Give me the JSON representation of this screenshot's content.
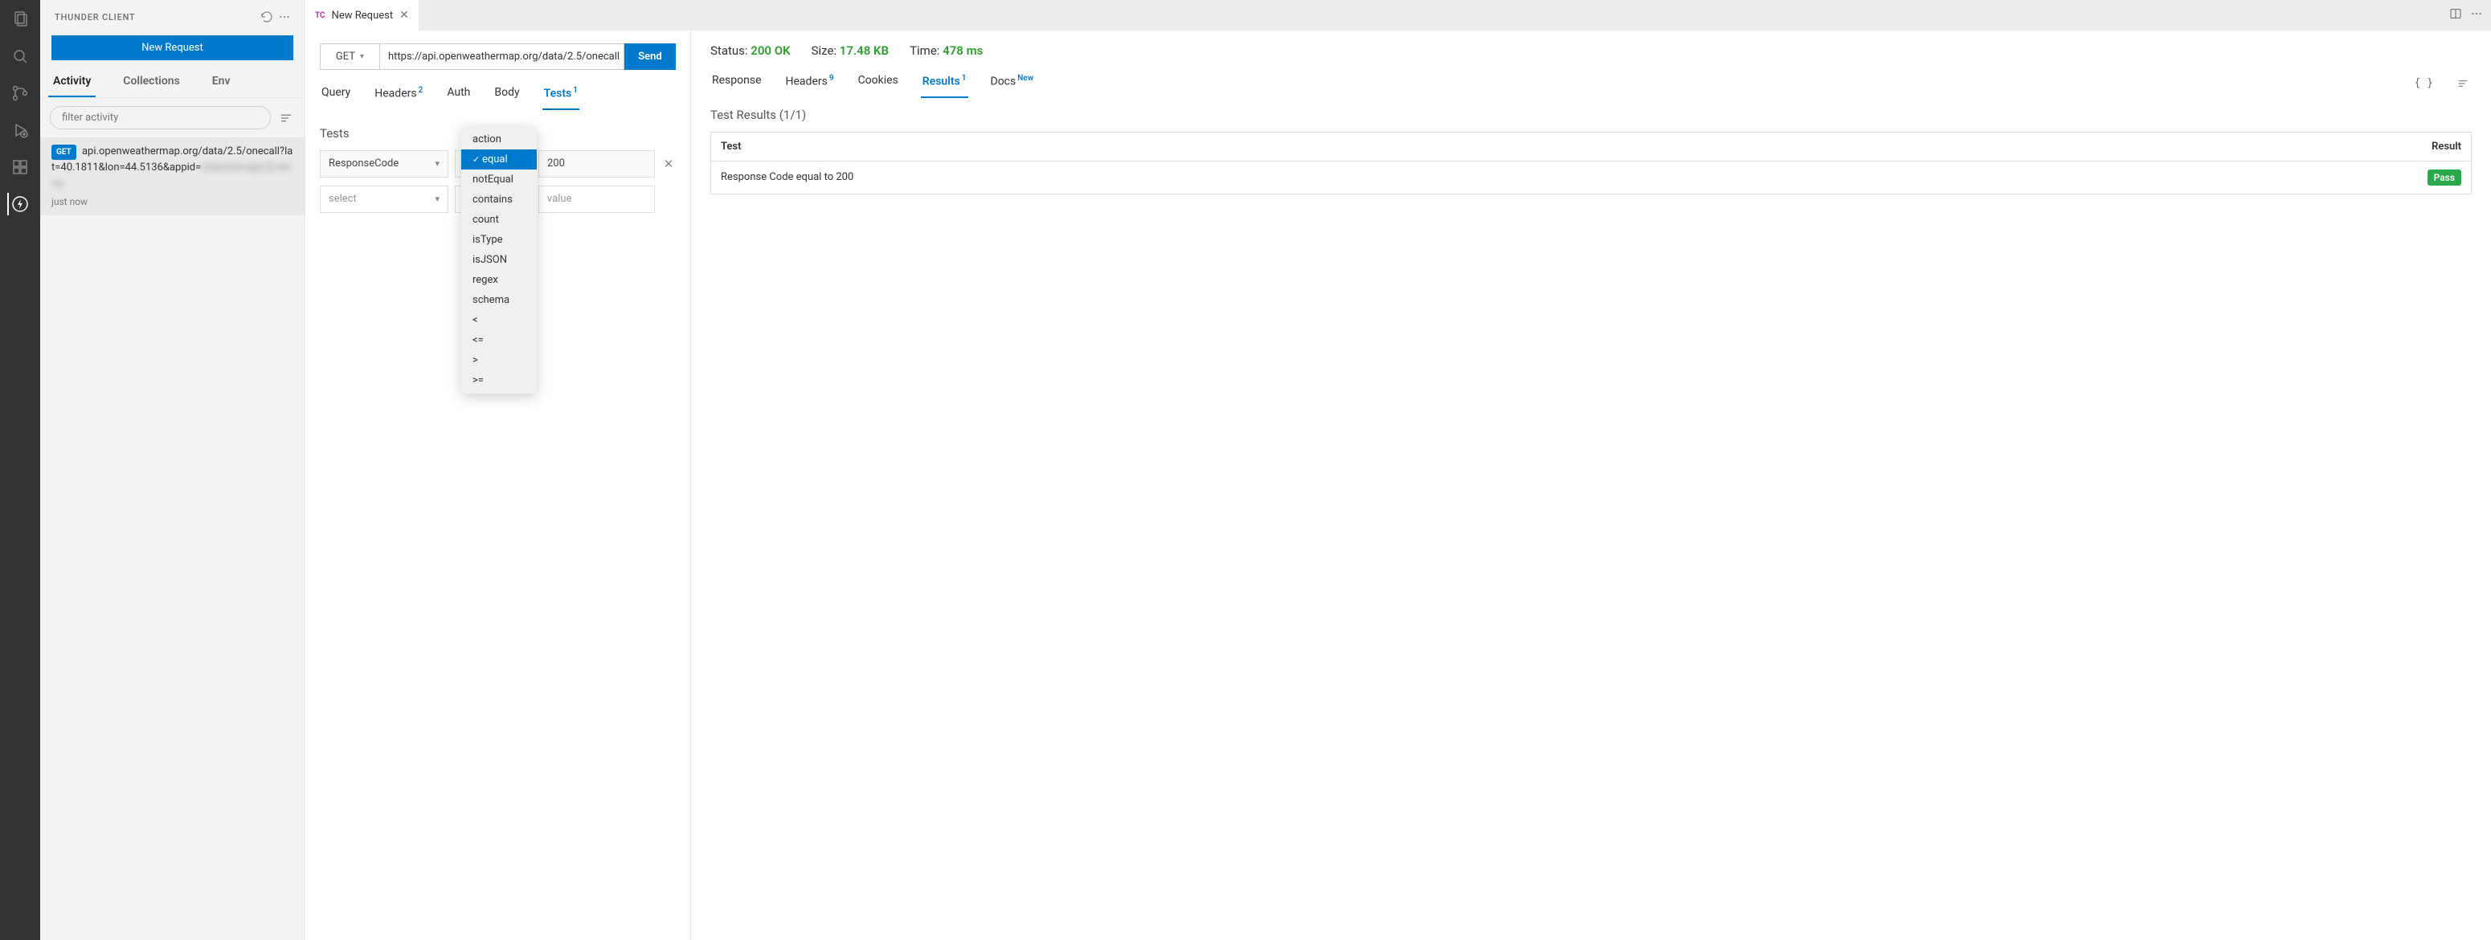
{
  "activity_icons": [
    "files",
    "search",
    "source-control",
    "debug",
    "extensions",
    "thunder"
  ],
  "sidebar": {
    "title": "THUNDER CLIENT",
    "new_request_label": "New Request",
    "tabs": [
      "Activity",
      "Collections",
      "Env"
    ],
    "active_tab": 0,
    "filter_placeholder": "filter activity",
    "request_item": {
      "method": "GET",
      "url_visible": "api.openweathermap.org/data/2.5/onecall?lat=40.1811&lon=44.5136&appid=",
      "url_blurred": "redacted-app-id-string",
      "time": "just now"
    }
  },
  "editor_tab": {
    "badge": "TC",
    "title": "New Request"
  },
  "request": {
    "method": "GET",
    "url": "https://api.openweathermap.org/data/2.5/onecall",
    "send_label": "Send",
    "subtabs": [
      {
        "label": "Query",
        "sup": ""
      },
      {
        "label": "Headers",
        "sup": "2"
      },
      {
        "label": "Auth",
        "sup": ""
      },
      {
        "label": "Body",
        "sup": ""
      },
      {
        "label": "Tests",
        "sup": "1"
      }
    ],
    "active_subtab": 4,
    "tests_title": "Tests",
    "tests_rows": [
      {
        "field": "ResponseCode",
        "op": "equal",
        "value": "200"
      },
      {
        "field_placeholder": "select",
        "value_placeholder": "value"
      }
    ],
    "dropdown_options": [
      "action",
      "equal",
      "notEqual",
      "contains",
      "count",
      "isType",
      "isJSON",
      "regex",
      "schema",
      "<",
      "<=",
      ">",
      ">="
    ],
    "dropdown_selected": "equal"
  },
  "response": {
    "status_label": "Status:",
    "status_value": "200 OK",
    "size_label": "Size:",
    "size_value": "17.48 KB",
    "time_label": "Time:",
    "time_value": "478 ms",
    "subtabs": [
      {
        "label": "Response",
        "sup": ""
      },
      {
        "label": "Headers",
        "sup": "9"
      },
      {
        "label": "Cookies",
        "sup": ""
      },
      {
        "label": "Results",
        "sup": "1"
      },
      {
        "label": "Docs",
        "sup": "New"
      }
    ],
    "active_subtab": 3,
    "results_title": "Test Results (1/1)",
    "table_headers": {
      "test": "Test",
      "result": "Result"
    },
    "results": [
      {
        "test": "Response Code equal to 200",
        "result": "Pass"
      }
    ]
  }
}
